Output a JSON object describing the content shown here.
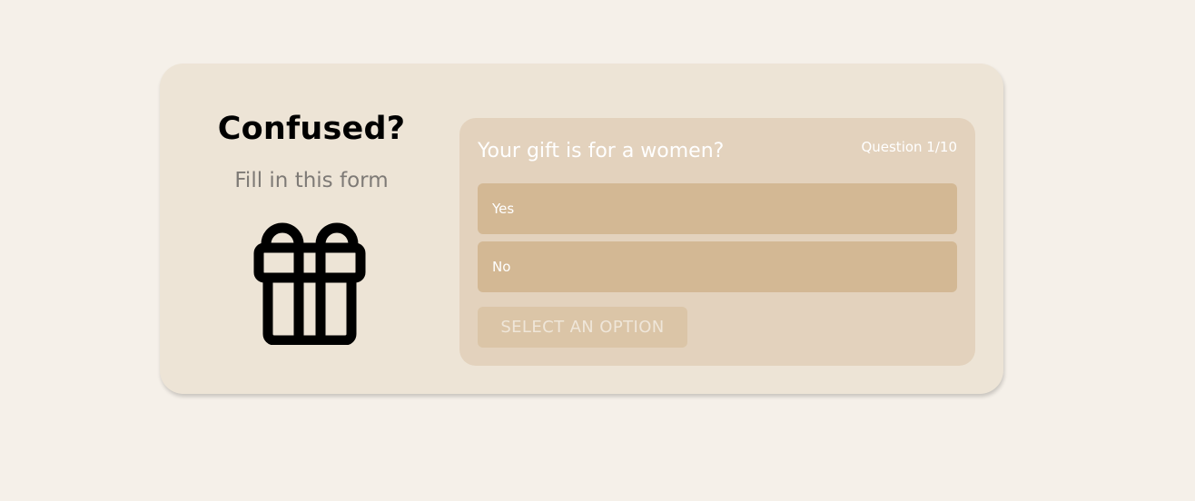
{
  "intro": {
    "heading": "Confused?",
    "subheading": "Fill in this form",
    "icon": "gift-icon"
  },
  "quiz": {
    "question": "Your gift is for a women?",
    "counter": "Question 1/10",
    "options": [
      {
        "label": "Yes"
      },
      {
        "label": "No"
      }
    ],
    "submit_label": "SELECT AN OPTION"
  },
  "colors": {
    "page_background": "#f5f0e9",
    "card_background": "#ede4d6",
    "form_background": "#e3d2bd",
    "option_background": "#d3b894",
    "button_disabled_background": "#dbc5a7",
    "heading_text": "#000000",
    "subheading_text": "#7e7a76"
  }
}
